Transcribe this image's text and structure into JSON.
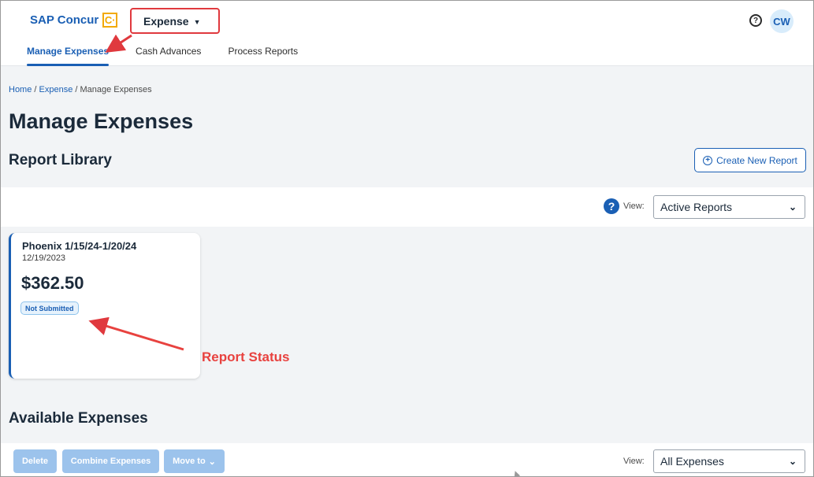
{
  "header": {
    "logo_text": "SAP Concur",
    "logo_mark": "C·",
    "app_menu_label": "Expense",
    "avatar_initials": "CW"
  },
  "nav": {
    "items": [
      {
        "label": "Manage Expenses",
        "active": true
      },
      {
        "label": "Cash Advances",
        "active": false
      },
      {
        "label": "Process Reports",
        "active": false
      }
    ]
  },
  "breadcrumb": {
    "home": "Home",
    "sep1": " / ",
    "expense": "Expense",
    "sep2": " / ",
    "current": "Manage Expenses"
  },
  "page": {
    "title": "Manage Expenses",
    "report_library_title": "Report Library",
    "create_report_label": "Create New Report"
  },
  "report_filter": {
    "view_label": "View:",
    "selected": "Active Reports"
  },
  "report_card": {
    "name": "Phoenix 1/15/24-1/20/24",
    "date": "12/19/2023",
    "amount": "$362.50",
    "status": "Not Submitted"
  },
  "annotation": {
    "label": "Report Status",
    "color": "#e8423f"
  },
  "available_expenses": {
    "title": "Available Expenses",
    "delete_label": "Delete",
    "combine_label": "Combine Expenses",
    "move_label": "Move to",
    "view_label": "View:",
    "selected": "All Expenses"
  },
  "colors": {
    "brand_blue": "#1a5fb4",
    "accent_yellow": "#f2a900",
    "annotation_red": "#e0393e"
  }
}
